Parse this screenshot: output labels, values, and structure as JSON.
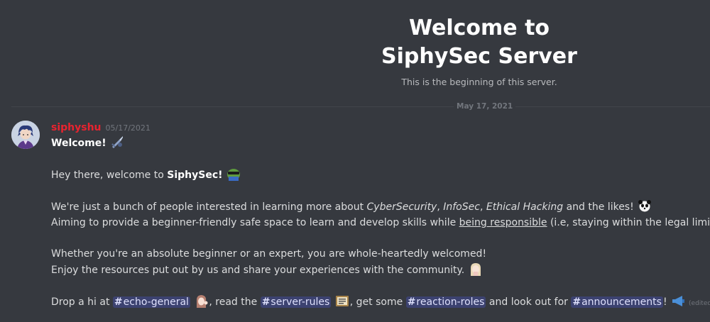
{
  "header": {
    "title_line1": "Welcome to",
    "title_line2": "SiphySec Server",
    "subtitle": "This is the beginning of this server."
  },
  "divider": {
    "date": "May 17, 2021"
  },
  "message": {
    "author": "siphyshu",
    "timestamp": "05/17/2021",
    "lines": {
      "l1_bold": "Welcome!",
      "l2_pre": "Hey there, welcome to ",
      "l2_bold": "SiphySec!",
      "l3_pre": "We're just a bunch of people interested in learning more about ",
      "l3_it1": "CyberSecurity",
      "l3_sep1": ", ",
      "l3_it2": "InfoSec",
      "l3_sep2": ", ",
      "l3_it3": "Ethical Hacking",
      "l3_post": " and the likes!",
      "l4_pre": "Aiming to provide a beginner-friendly safe space to learn and develop skills while ",
      "l4_u": "being responsible",
      "l4_post": " (i.e, staying within the legal limits!).",
      "l5": "Whether you're an absolute beginner or an expert, you are whole-heartedly welcomed!",
      "l6": "Enjoy the resources put out by us and share your experiences with the community.",
      "l7_a": "Drop a hi at ",
      "l7_b": " read the ",
      "l7_c": " get some ",
      "l7_d": " and look out for ",
      "l7_e": "!",
      "comma": ",",
      "hash": "#"
    },
    "channels": {
      "echo_general": "echo-general",
      "server_rules": "server-rules",
      "reaction_roles": "reaction-roles",
      "announcements": "announcements"
    },
    "edited": "(edited)"
  },
  "emojis": {
    "welcome": "sword-icon",
    "siphysec": "pepe-sunglasses-icon",
    "likes": "panda-icon",
    "community": "anime-girl-icon",
    "echo_general": "anime-wave-icon",
    "server_rules": "read-rules-icon",
    "announcements": "megaphone-icon"
  },
  "colors": {
    "background": "#36393f",
    "username": "#e8232f",
    "mention_bg": "#3c4270",
    "mention_text": "#dee0fc"
  }
}
